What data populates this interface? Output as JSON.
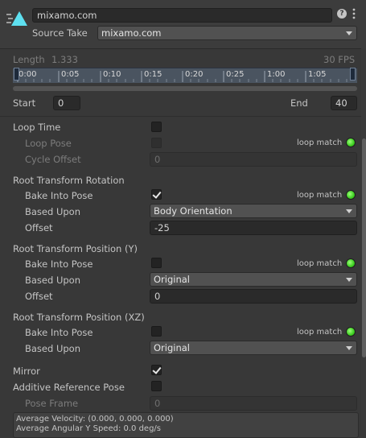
{
  "header": {
    "name": "mixamo.com",
    "source_take_label": "Source Take",
    "source_take_value": "mixamo.com",
    "help_icon": "question-mark-icon",
    "menu_icon": "kebab-menu-icon"
  },
  "timeline": {
    "length_label": "Length",
    "length_value": "1.333",
    "fps_label": "30 FPS",
    "ticks": [
      "0:00",
      "0:05",
      "0:10",
      "0:15",
      "0:20",
      "0:25",
      "1:00",
      "1:05"
    ]
  },
  "range": {
    "start_label": "Start",
    "start_value": "0",
    "end_label": "End",
    "end_value": "40"
  },
  "loop": {
    "loop_time_label": "Loop Time",
    "loop_pose_label": "Loop Pose",
    "loop_match_label": "loop match",
    "cycle_offset_label": "Cycle Offset",
    "cycle_offset_value": "0"
  },
  "root_rotation": {
    "title": "Root Transform Rotation",
    "bake_label": "Bake Into Pose",
    "loop_match_label": "loop match",
    "based_upon_label": "Based Upon",
    "based_upon_value": "Body Orientation",
    "offset_label": "Offset",
    "offset_value": "-25"
  },
  "root_position_y": {
    "title": "Root Transform Position (Y)",
    "bake_label": "Bake Into Pose",
    "loop_match_label": "loop match",
    "based_upon_label": "Based Upon",
    "based_upon_value": "Original",
    "offset_label": "Offset",
    "offset_value": "0"
  },
  "root_position_xz": {
    "title": "Root Transform Position (XZ)",
    "bake_label": "Bake Into Pose",
    "loop_match_label": "loop match",
    "based_upon_label": "Based Upon",
    "based_upon_value": "Original"
  },
  "misc": {
    "mirror_label": "Mirror",
    "additive_label": "Additive Reference Pose",
    "pose_frame_label": "Pose Frame",
    "pose_frame_value": "0"
  },
  "info": {
    "avg_velocity": "Average Velocity: (0.000, 0.000, 0.000)",
    "avg_angular": "Average Angular Y Speed: 0.0 deg/s"
  },
  "colors": {
    "background": "#383838",
    "led_green": "#3ccd20",
    "logo_cyan": "#5ee0f0"
  }
}
